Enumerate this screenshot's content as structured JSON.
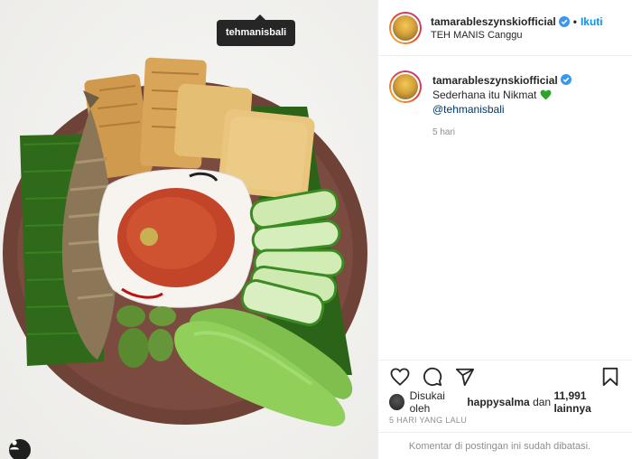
{
  "photo": {
    "tag_label": "tehmanisbali",
    "image_alt": "food-photo",
    "colors": {
      "plate": "#7a4a3c",
      "leaf": "#2f6b1c",
      "tempe": "#d9a659",
      "tofu": "#e8c57b",
      "sambal": "#c2452a",
      "cucumber": "#c8e6a4",
      "fish": "#8c7a5c"
    }
  },
  "header": {
    "username": "tamarableszynskiofficial",
    "separator": "•",
    "follow_label": "Ikuti",
    "location": "TEH MANIS Canggu"
  },
  "caption": {
    "username": "tamarableszynskiofficial",
    "text_before": "Sederhana itu Nikmat",
    "mention": "@tehmanisbali",
    "time_ago": "5 hari"
  },
  "actions": {
    "icons": [
      "heart-icon",
      "comment-icon",
      "share-icon",
      "bookmark-icon"
    ]
  },
  "likes": {
    "prefix": "Disukai oleh",
    "user": "happysalma",
    "middle": "dan",
    "count": "11,991 lainnya"
  },
  "date": "5 HARI YANG LALU",
  "comments_disabled": "Komentar di postingan ini sudah dibatasi."
}
